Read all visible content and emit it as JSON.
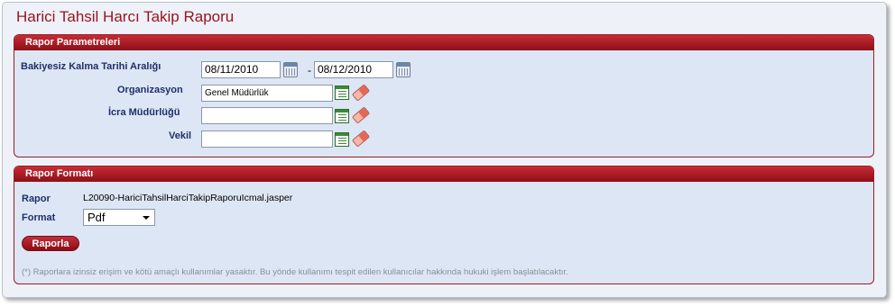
{
  "page": {
    "title": "Harici Tahsil Harcı Takip Raporu"
  },
  "parameters_panel": {
    "title": "Rapor Parametreleri",
    "date_range": {
      "label": "Bakiyesiz Kalma Tarihi Aralığı",
      "from": "08/11/2010",
      "separator": "-",
      "to": "08/12/2010"
    },
    "organizasyon": {
      "label": "Organizasyon",
      "value": "Genel Müdürlük"
    },
    "icra_mudurlugu": {
      "label": "İcra Müdürlüğü",
      "value": ""
    },
    "vekil": {
      "label": "Vekil",
      "value": ""
    }
  },
  "format_panel": {
    "title": "Rapor Formatı",
    "rapor": {
      "label": "Rapor",
      "value": "L20090-HariciTahsilHarciTakipRaporuIcmal.jasper"
    },
    "format": {
      "label": "Format",
      "selected": "Pdf"
    },
    "button_label": "Raporla",
    "note": "(*) Raporlara izinsiz erişim ve kötü amaçlı kullanımlar yasaktır. Bu yönde kullanımı tespit edilen kullanıcılar hakkında hukuki işlem başlatılacaktır."
  },
  "icons": [
    "calendar-icon",
    "list-select-icon",
    "eraser-icon",
    "dropdown-arrow-icon"
  ],
  "colors": {
    "title": "#9a1420",
    "panel_header": "#b3202b",
    "label": "#1f2f6b",
    "panel_bg": "#dde6f4"
  }
}
